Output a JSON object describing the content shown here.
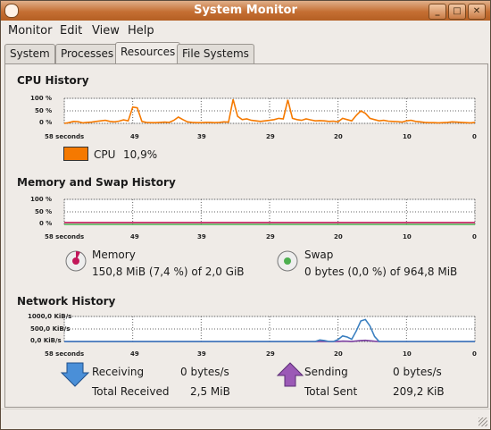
{
  "window": {
    "title": "System Monitor",
    "buttons": [
      "_",
      "□",
      "✕"
    ]
  },
  "menubar": {
    "items": [
      "Monitor",
      "Edit",
      "View",
      "Help"
    ]
  },
  "tabs": [
    "System",
    "Processes",
    "Resources",
    "File Systems"
  ],
  "active_tab": "Resources",
  "cpu": {
    "title": "CPU History",
    "y_ticks": [
      "100 %",
      "50 %",
      "0 %"
    ],
    "x_ticks": [
      "58 seconds",
      "49",
      "39",
      "29",
      "20",
      "10",
      "0"
    ],
    "legend_label": "CPU",
    "legend_value": "10,9%",
    "color": "#f57900",
    "series": [
      0,
      3,
      8,
      7,
      2,
      4,
      5,
      8,
      10,
      12,
      8,
      6,
      9,
      14,
      10,
      65,
      62,
      8,
      4,
      3,
      3,
      4,
      5,
      4,
      12,
      25,
      15,
      6,
      4,
      3,
      3,
      4,
      4,
      3,
      4,
      6,
      5,
      96,
      28,
      15,
      18,
      12,
      10,
      8,
      10,
      12,
      15,
      20,
      18,
      94,
      20,
      15,
      12,
      18,
      14,
      10,
      11,
      10,
      8,
      9,
      6,
      20,
      15,
      10,
      32,
      50,
      40,
      20,
      15,
      10,
      12,
      9,
      8,
      7,
      5,
      10,
      12,
      8,
      6,
      4,
      3,
      3,
      2,
      3,
      4,
      6,
      5,
      4,
      3,
      2,
      4
    ]
  },
  "memory": {
    "title": "Memory and Swap History",
    "y_ticks": [
      "100 %",
      "50 %",
      "0 %"
    ],
    "x_ticks": [
      "58 seconds",
      "49",
      "39",
      "29",
      "20",
      "10",
      "0"
    ],
    "memory_label": "Memory",
    "memory_value": "150,8 MiB (7,4 %) of 2,0 GiB",
    "memory_color": "#c2185b",
    "memory_percent": 7.4,
    "swap_label": "Swap",
    "swap_value": "0 bytes (0,0 %) of 964,8 MiB",
    "swap_color": "#4caf50",
    "swap_percent": 0.0
  },
  "network": {
    "title": "Network History",
    "y_ticks": [
      "1000,0 KiB/s",
      "500,0 KiB/s",
      "0,0 KiB/s"
    ],
    "x_ticks": [
      "58 seconds",
      "49",
      "39",
      "29",
      "20",
      "10",
      "0"
    ],
    "receiving_label": "Receiving",
    "receiving_value": "0 bytes/s",
    "total_received_label": "Total Received",
    "total_received_value": "2,5 MiB",
    "sending_label": "Sending",
    "sending_value": "0 bytes/s",
    "total_sent_label": "Total Sent",
    "total_sent_value": "209,2 KiB",
    "receive_color": "#3a7fc0",
    "send_color": "#7b3fa0",
    "receive_series": [
      0,
      0,
      0,
      0,
      0,
      0,
      0,
      0,
      0,
      0,
      0,
      0,
      0,
      0,
      0,
      0,
      0,
      0,
      0,
      0,
      0,
      0,
      0,
      0,
      0,
      0,
      0,
      0,
      0,
      0,
      0,
      0,
      0,
      0,
      0,
      0,
      0,
      0,
      0,
      0,
      0,
      0,
      0,
      0,
      0,
      0,
      0,
      0,
      0,
      0,
      0,
      0,
      0,
      0,
      0,
      0,
      60,
      40,
      0,
      0,
      80,
      220,
      180,
      90,
      420,
      820,
      880,
      620,
      200,
      0,
      0,
      0,
      0,
      0,
      0,
      0,
      0,
      0,
      0,
      0,
      0,
      0,
      0,
      0,
      0,
      0,
      0,
      0,
      0,
      0,
      0
    ],
    "send_series": [
      0,
      0,
      0,
      0,
      0,
      0,
      0,
      0,
      0,
      0,
      0,
      0,
      0,
      0,
      0,
      0,
      0,
      0,
      0,
      0,
      0,
      0,
      0,
      0,
      0,
      0,
      0,
      0,
      0,
      0,
      0,
      0,
      0,
      0,
      0,
      0,
      0,
      0,
      0,
      0,
      0,
      0,
      0,
      0,
      0,
      0,
      0,
      0,
      0,
      0,
      0,
      0,
      0,
      0,
      0,
      0,
      5,
      5,
      0,
      0,
      5,
      15,
      10,
      5,
      20,
      40,
      45,
      30,
      10,
      0,
      0,
      0,
      0,
      0,
      0,
      0,
      0,
      0,
      0,
      0,
      0,
      0,
      0,
      0,
      0,
      0,
      0,
      0,
      0,
      0,
      0
    ]
  }
}
